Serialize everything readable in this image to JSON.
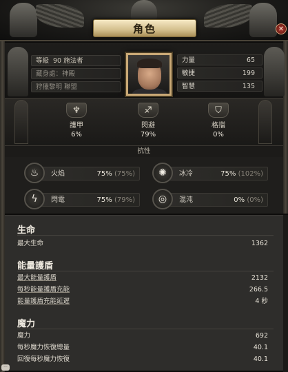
{
  "window": {
    "title": "角色",
    "close_glyph": "✕"
  },
  "identity": {
    "level_label": "等級",
    "level_value": "90",
    "class_name": "施法者",
    "location_label": "藏身處：",
    "location_value": "神殿",
    "guild_name": "狩獵黎明 聯盟"
  },
  "attributes": [
    {
      "label": "力量",
      "value": "65"
    },
    {
      "label": "敏捷",
      "value": "199"
    },
    {
      "label": "智慧",
      "value": "135"
    }
  ],
  "defenses": [
    {
      "label": "護甲",
      "value": "6%",
      "icon": "armour-icon",
      "glyph": "♆"
    },
    {
      "label": "閃避",
      "value": "79%",
      "icon": "evasion-icon",
      "glyph": "♐"
    },
    {
      "label": "格擋",
      "value": "0%",
      "icon": "block-icon",
      "glyph": "⛉"
    }
  ],
  "resist_title": "抗性",
  "resists": [
    {
      "label": "火焰",
      "value": "75%",
      "max": "(75%)",
      "icon": "fire-icon",
      "glyph": "♨"
    },
    {
      "label": "冰冷",
      "value": "75%",
      "max": "(102%)",
      "icon": "cold-icon",
      "glyph": "✺"
    },
    {
      "label": "閃電",
      "value": "75%",
      "max": "(79%)",
      "icon": "lightning-icon",
      "glyph": "ϟ"
    },
    {
      "label": "混沌",
      "value": "0%",
      "max": "(0%)",
      "icon": "chaos-icon",
      "glyph": "◎"
    }
  ],
  "life": {
    "heading": "生命",
    "rows": [
      {
        "label": "最大生命",
        "value": "1362"
      }
    ]
  },
  "es": {
    "heading": "能量護盾",
    "rows": [
      {
        "label": "最大能量護盾",
        "value": "2132"
      },
      {
        "label": "每秒能量護盾充能",
        "value": "266.5"
      },
      {
        "label": "能量護盾充能延遲",
        "value": "4 秒"
      }
    ]
  },
  "mana": {
    "heading": "魔力",
    "rows": [
      {
        "label": "魔力",
        "value": "692"
      },
      {
        "label": "每秒魔力恢復總量",
        "value": "40.1"
      },
      {
        "label": "回復每秒魔力恢復",
        "value": "40.1"
      }
    ]
  }
}
